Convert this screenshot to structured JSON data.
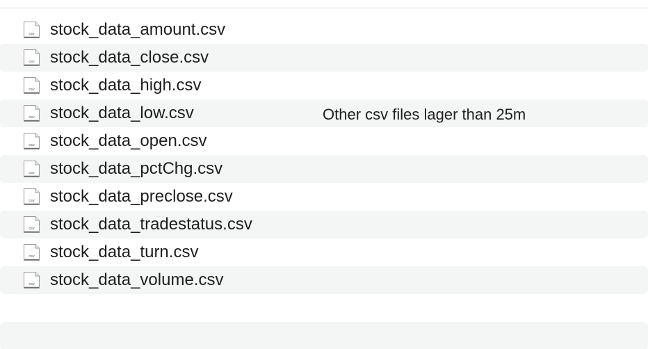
{
  "files": [
    {
      "name": "stock_data_amount.csv",
      "icon": "csv-file-icon",
      "icon_label": "csv"
    },
    {
      "name": "stock_data_close.csv",
      "icon": "csv-file-icon",
      "icon_label": "csv"
    },
    {
      "name": "stock_data_high.csv",
      "icon": "csv-file-icon",
      "icon_label": "csv"
    },
    {
      "name": "stock_data_low.csv",
      "icon": "csv-file-icon",
      "icon_label": "csv"
    },
    {
      "name": "stock_data_open.csv",
      "icon": "csv-file-icon",
      "icon_label": "csv"
    },
    {
      "name": "stock_data_pctChg.csv",
      "icon": "csv-file-icon",
      "icon_label": "csv"
    },
    {
      "name": "stock_data_preclose.csv",
      "icon": "csv-file-icon",
      "icon_label": "csv"
    },
    {
      "name": "stock_data_tradestatus.csv",
      "icon": "csv-file-icon",
      "icon_label": "csv"
    },
    {
      "name": "stock_data_turn.csv",
      "icon": "csv-file-icon",
      "icon_label": "csv"
    },
    {
      "name": "stock_data_volume.csv",
      "icon": "csv-file-icon",
      "icon_label": "csv"
    }
  ],
  "note": "Other csv files lager than 25m",
  "colors": {
    "stripe": "#f4f5f5",
    "text": "#1e1e1e",
    "divider": "#d9d9d9"
  }
}
